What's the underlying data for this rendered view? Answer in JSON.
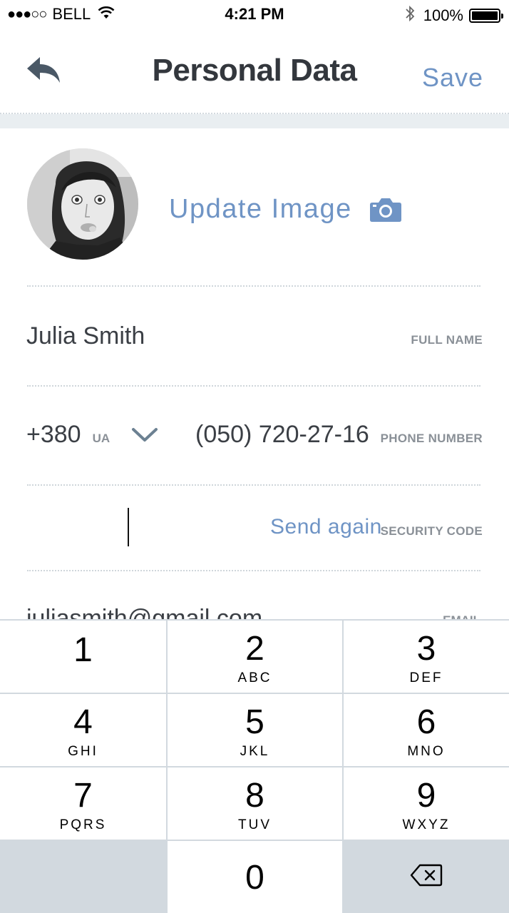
{
  "status_bar": {
    "signal": "●●●○○",
    "carrier": "BELL",
    "time": "4:21 PM",
    "battery": "100%",
    "icons": [
      "wifi-icon",
      "bluetooth-icon",
      "battery-icon"
    ]
  },
  "header": {
    "title": "Personal Data",
    "save_label": "Save",
    "back_icon": "back-arrow-icon"
  },
  "profile": {
    "update_label": "Update Image",
    "camera_icon": "camera-icon"
  },
  "form": {
    "full_name": {
      "value": "Julia Smith",
      "label": "FULL NAME"
    },
    "phone": {
      "country_code": "+380",
      "country_iso": "UA",
      "number": "(050) 720-27-16",
      "label": "PHONE NUMBER"
    },
    "security_code": {
      "value": "",
      "send_again": "Send again",
      "label": "SECURITY CODE"
    },
    "email": {
      "value": "juliasmith@gmail.com",
      "label": "EMAIL"
    }
  },
  "keypad": {
    "keys": [
      {
        "num": "1",
        "letters": ""
      },
      {
        "num": "2",
        "letters": "ABC"
      },
      {
        "num": "3",
        "letters": "DEF"
      },
      {
        "num": "4",
        "letters": "GHI"
      },
      {
        "num": "5",
        "letters": "JKL"
      },
      {
        "num": "6",
        "letters": "MNO"
      },
      {
        "num": "7",
        "letters": "PQRS"
      },
      {
        "num": "8",
        "letters": "TUV"
      },
      {
        "num": "9",
        "letters": "WXYZ"
      },
      {
        "num": "0",
        "letters": ""
      }
    ],
    "delete_icon": "backspace-icon"
  },
  "colors": {
    "accent": "#6f94c5",
    "text": "#3b3f45",
    "label": "#8a9097",
    "keypad_bg": "#d2d9df"
  }
}
